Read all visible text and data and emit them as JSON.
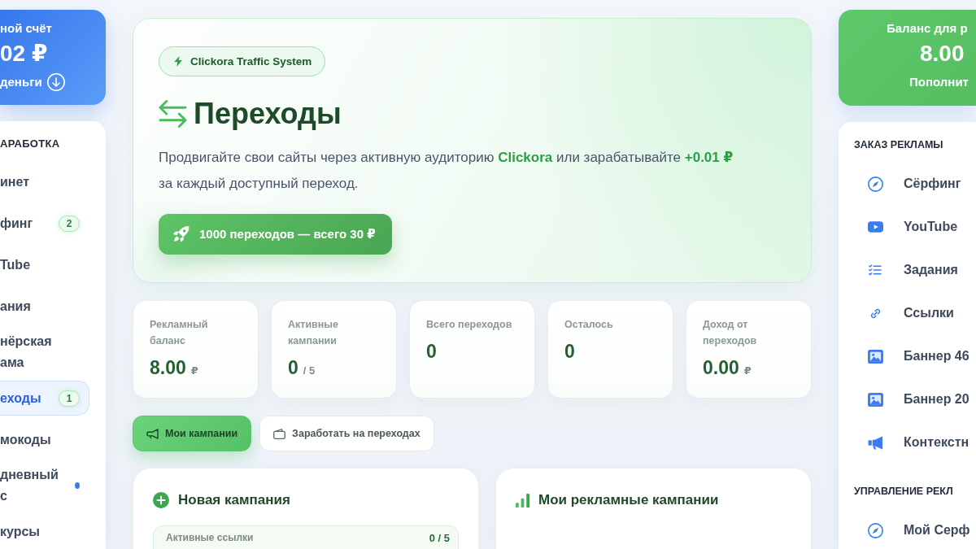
{
  "account_card": {
    "title": "ной счёт",
    "amount": "02 ₽",
    "link": "деньги"
  },
  "left_menu": {
    "heading": "АРАБОТКА",
    "items": [
      {
        "lines": [
          "инет"
        ],
        "selected": false,
        "dot": false
      },
      {
        "lines": [
          "финг"
        ],
        "badge": "2",
        "selected": false,
        "dot": false
      },
      {
        "lines": [
          "Tube"
        ],
        "selected": false,
        "dot": false
      },
      {
        "lines": [
          "ания"
        ],
        "selected": false,
        "dot": false
      },
      {
        "lines": [
          "нёрская",
          "ама"
        ],
        "selected": false,
        "dot": false
      },
      {
        "lines": [
          "еходы"
        ],
        "badge": "1",
        "selected": true,
        "dot": false
      },
      {
        "lines": [
          "мокоды"
        ],
        "selected": false,
        "dot": false
      },
      {
        "lines": [
          "дневный",
          "с"
        ],
        "selected": false,
        "dot": true
      },
      {
        "lines": [
          "курсы"
        ],
        "selected": false,
        "dot": false
      }
    ]
  },
  "hero": {
    "chip": "Clickora Traffic System",
    "title": "Переходы",
    "text": "Продвигайте свои сайты через активную аудиторию **Clickora** или зарабатывайте **+0.01 ₽** за каждый доступный переход.",
    "button": "1000 переходов — всего 30 ₽"
  },
  "stats": [
    {
      "label": "Рекламный баланс",
      "value": "8.00",
      "suffix": "₽"
    },
    {
      "label": "Активные кампании",
      "value": "0",
      "suffix": "/ 5"
    },
    {
      "label": "Всего переходов",
      "value": "0"
    },
    {
      "label": "Осталось",
      "value": "0"
    },
    {
      "label": "Доход от переходов",
      "value": "0.00",
      "suffix": "₽"
    }
  ],
  "tabs": [
    {
      "label": "Мои кампании",
      "kind": "campaigns",
      "selected": true
    },
    {
      "label": "Заработать на переходах",
      "kind": "earn",
      "selected": false
    }
  ],
  "new_campaign": {
    "title": "Новая кампания",
    "rows": [
      {
        "label": "Активные ссылки",
        "value": "0 / 5"
      }
    ]
  },
  "campaigns": {
    "title": "Мои рекламные кампании"
  },
  "balance_card": {
    "title": "Баланс для р",
    "amount": "8.00",
    "link": "Пополнит"
  },
  "right_menu": {
    "sections": [
      {
        "heading": "ЗАКАЗ РЕКЛАМЫ",
        "items": [
          {
            "label": "Сёрфинг",
            "kind": "surf",
            "selected": false
          },
          {
            "label": "YouTube",
            "kind": "video",
            "selected": false
          },
          {
            "label": "Задания",
            "kind": "tasks",
            "selected": false
          },
          {
            "label": "Ссылки",
            "kind": "links",
            "selected": false
          },
          {
            "label": "Баннер 46",
            "kind": "banner",
            "selected": false
          },
          {
            "label": "Баннер 20",
            "kind": "banner",
            "selected": false
          },
          {
            "label": "Контекстн",
            "kind": "context",
            "selected": false
          }
        ]
      },
      {
        "heading": "УПРАВЛЕНИЕ РЕКЛ",
        "items": [
          {
            "label": "Мой Серф",
            "kind": "surf",
            "selected": false
          }
        ]
      }
    ]
  }
}
